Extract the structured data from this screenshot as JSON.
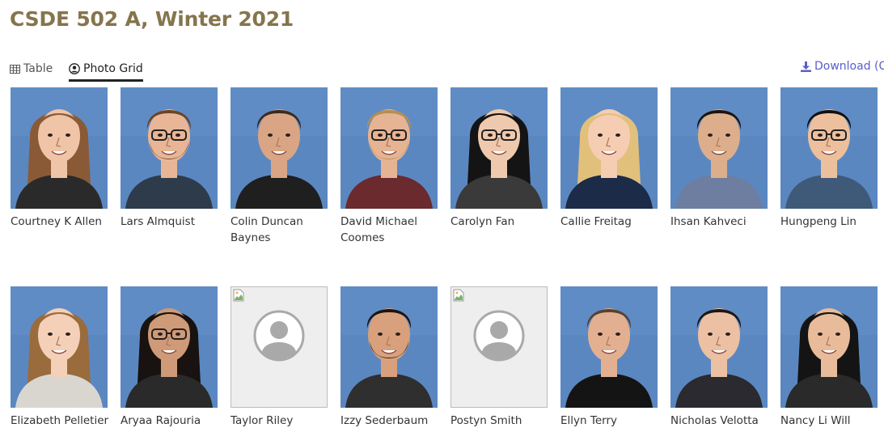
{
  "page": {
    "title": "CSDE 502 A, Winter 2021"
  },
  "tabs": [
    {
      "label": "Table",
      "icon": "table-icon",
      "active": false
    },
    {
      "label": "Photo Grid",
      "icon": "user-circle-icon",
      "active": true
    }
  ],
  "download": {
    "label": "Download (C",
    "icon": "download-icon"
  },
  "colors": {
    "title": "#85754d",
    "link": "#5b5fc7",
    "photo_background": "#5b87c1"
  },
  "students": [
    {
      "name": "Courtney K Allen",
      "has_photo": true,
      "hair": "#8a5a36",
      "skin": "#f0c4a6",
      "shirt": "#2a2a2a",
      "glasses": false,
      "beard": false,
      "hair_style": "long"
    },
    {
      "name": "Lars Almquist",
      "has_photo": true,
      "hair": "#6b4428",
      "skin": "#e8b696",
      "shirt": "#2d3b4a",
      "glasses": true,
      "beard": true,
      "hair_style": "short"
    },
    {
      "name": "Colin Duncan Baynes",
      "has_photo": true,
      "hair": "#3a2a20",
      "skin": "#d9a584",
      "shirt": "#1f1f1f",
      "glasses": false,
      "beard": false,
      "hair_style": "short"
    },
    {
      "name": "David Michael Coomes",
      "has_photo": true,
      "hair": "#b58e52",
      "skin": "#e6b393",
      "shirt": "#6a2a2e",
      "glasses": true,
      "beard": true,
      "hair_style": "short"
    },
    {
      "name": "Carolyn Fan",
      "has_photo": true,
      "hair": "#141414",
      "skin": "#efc9ad",
      "shirt": "#3a3a3a",
      "glasses": true,
      "beard": false,
      "hair_style": "long"
    },
    {
      "name": "Callie Freitag",
      "has_photo": true,
      "hair": "#e1c07c",
      "skin": "#f5cdb2",
      "shirt": "#1b2b48",
      "glasses": false,
      "beard": false,
      "hair_style": "long"
    },
    {
      "name": "Ihsan Kahveci",
      "has_photo": true,
      "hair": "#1c1410",
      "skin": "#dcae8c",
      "shirt": "#6d7ea0",
      "glasses": false,
      "beard": false,
      "hair_style": "short"
    },
    {
      "name": "Hungpeng Lin",
      "has_photo": true,
      "hair": "#111111",
      "skin": "#ecc09d",
      "shirt": "#3f5a78",
      "glasses": true,
      "beard": false,
      "hair_style": "short"
    },
    {
      "name": "Elizabeth Pelletier",
      "has_photo": true,
      "hair": "#9a6b3c",
      "skin": "#f4d0b8",
      "shirt": "#d9d6d0",
      "glasses": false,
      "beard": false,
      "hair_style": "long"
    },
    {
      "name": "Aryaa Rajouria",
      "has_photo": true,
      "hair": "#181210",
      "skin": "#cf9a78",
      "shirt": "#2a2a2a",
      "glasses": true,
      "beard": false,
      "hair_style": "long"
    },
    {
      "name": "Taylor Riley",
      "has_photo": false
    },
    {
      "name": "Izzy Sederbaum",
      "has_photo": true,
      "hair": "#1b1410",
      "skin": "#d8a07c",
      "shirt": "#2f2f2f",
      "glasses": false,
      "beard": true,
      "hair_style": "short"
    },
    {
      "name": "Postyn Smith",
      "has_photo": false
    },
    {
      "name": "Ellyn Terry",
      "has_photo": true,
      "hair": "#5a4030",
      "skin": "#e2b091",
      "shirt": "#141414",
      "glasses": false,
      "beard": false,
      "hair_style": "short"
    },
    {
      "name": "Nicholas Velotta",
      "has_photo": true,
      "hair": "#1e1612",
      "skin": "#ecc0a2",
      "shirt": "#2a2a30",
      "glasses": false,
      "beard": false,
      "hair_style": "short"
    },
    {
      "name": "Nancy Li Will",
      "has_photo": true,
      "hair": "#141414",
      "skin": "#e8bc9a",
      "shirt": "#2a2a2a",
      "glasses": false,
      "beard": false,
      "hair_style": "long"
    }
  ]
}
